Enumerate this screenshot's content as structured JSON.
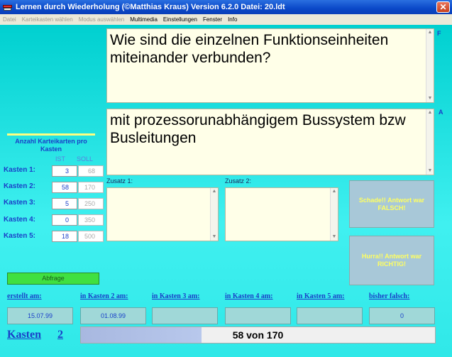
{
  "window": {
    "title": "Lernen durch Wiederholung     (©Matthias Kraus) Version 6.2.0    Datei:  20.ldt",
    "close_glyph": "✕"
  },
  "menu": [
    {
      "label": "Datei",
      "enabled": false
    },
    {
      "label": "Karteikasten wählen",
      "enabled": false
    },
    {
      "label": "Modus auswählen",
      "enabled": false
    },
    {
      "label": "Multimedia",
      "enabled": true
    },
    {
      "label": "Einstellungen",
      "enabled": true
    },
    {
      "label": "Fenster",
      "enabled": true
    },
    {
      "label": "Info",
      "enabled": true
    }
  ],
  "question": {
    "text": "Wie sind die einzelnen Funktionseinheiten miteinander verbunden?",
    "side_letter": "F"
  },
  "answer": {
    "text": "mit prozessorunabhängigem Bussystem bzw Busleitungen",
    "side_letter": "A"
  },
  "counts": {
    "title": "Anzahl Karteikarten pro Kasten",
    "ist_label": "IST",
    "soll_label": "SOLL",
    "rows": [
      {
        "label": "Kasten 1:",
        "ist": "3",
        "soll": "68"
      },
      {
        "label": "Kasten 2:",
        "ist": "58",
        "soll": "170"
      },
      {
        "label": "Kasten 3:",
        "ist": "5",
        "soll": "250"
      },
      {
        "label": "Kasten 4:",
        "ist": "0",
        "soll": "350"
      },
      {
        "label": "Kasten 5:",
        "ist": "18",
        "soll": "500"
      }
    ]
  },
  "zusatz": {
    "label1": "Zusatz 1:",
    "label2": "Zusatz 2:"
  },
  "buttons": {
    "wrong": "Schade!! Antwort war FALSCH!",
    "right": "Hurra!! Antwort war RICHTIG!",
    "abfrage": "Abfrage"
  },
  "dates": [
    {
      "label": "erstellt am:",
      "value": "15.07.99"
    },
    {
      "label": "in Kasten 2 am:",
      "value": "01.08.99"
    },
    {
      "label": "in Kasten 3 am:",
      "value": ""
    },
    {
      "label": "in Kasten 4 am:",
      "value": ""
    },
    {
      "label": "in Kasten 5 am:",
      "value": ""
    },
    {
      "label": "bisher falsch:",
      "value": "0"
    }
  ],
  "footer": {
    "kasten_label": "Kasten",
    "kasten_number": "2",
    "progress_text": "58 von  170",
    "progress_fraction": 0.34
  },
  "colors": {
    "accent": "#1a3fc8",
    "background": "#1fd8d8",
    "progress_fill": "#b0c0e8"
  },
  "icons": {
    "app": "app-icon",
    "close": "close-icon"
  }
}
